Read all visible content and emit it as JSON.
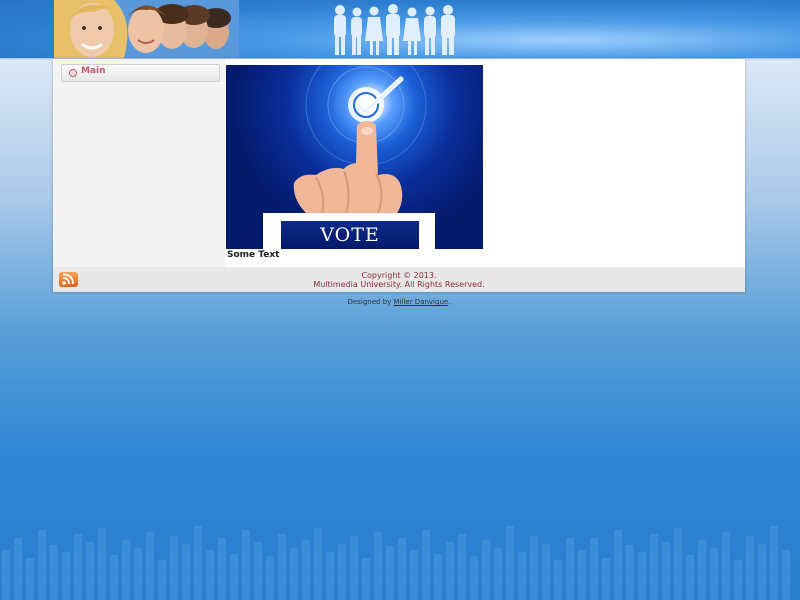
{
  "sidebar": {
    "items": [
      {
        "label": "Main",
        "icon": "bullet-icon"
      }
    ]
  },
  "content": {
    "image_text": "VOTE",
    "caption": "Some Text"
  },
  "footer": {
    "copyright_line1": "Copyright © 2013.",
    "copyright_line2": "Multimedia University. All Rights Reserved.",
    "rss_icon": "rss-icon"
  },
  "credits": {
    "prefix": "Designed by ",
    "author": "Miller Danvique",
    "suffix": "."
  },
  "colors": {
    "accent": "#c25a6e",
    "background_blue": "#2e86d4",
    "footer_text": "#8b2a3a"
  }
}
